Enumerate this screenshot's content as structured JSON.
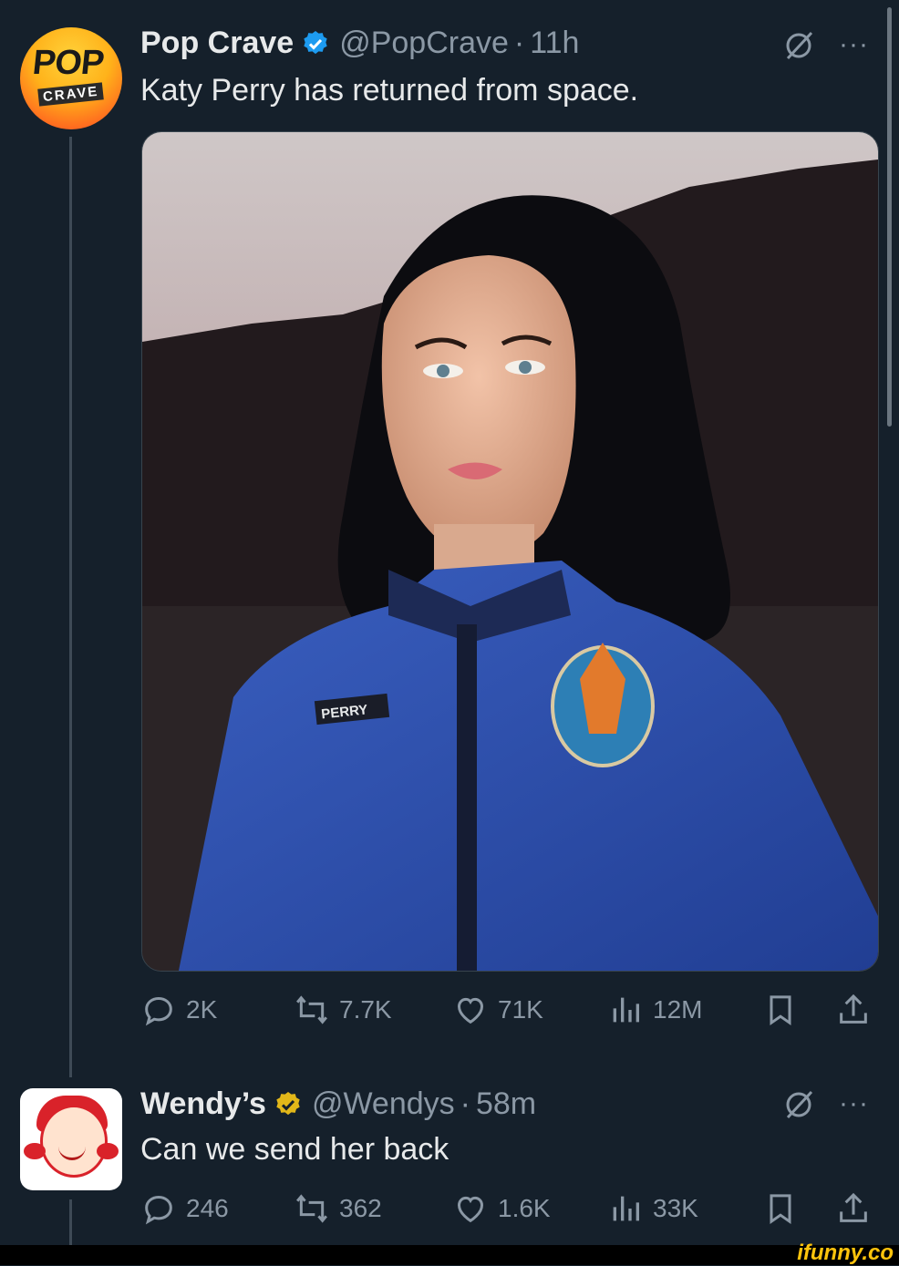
{
  "tweets": [
    {
      "name": "Pop Crave",
      "handle": "@PopCrave",
      "separator": "·",
      "time": "11h",
      "text": "Katy Perry has returned from space.",
      "avatar_word_top": "POP",
      "avatar_word_bottom": "CRAVE",
      "media_patch_text": "PERRY",
      "stats": {
        "replies": "2K",
        "reposts": "7.7K",
        "likes": "71K",
        "views": "12M"
      }
    },
    {
      "name": "Wendy’s",
      "handle": "@Wendys",
      "separator": "·",
      "time": "58m",
      "text": "Can we send her back",
      "stats": {
        "replies": "246",
        "reposts": "362",
        "likes": "1.6K",
        "views": "33K"
      }
    }
  ],
  "more_glyph": "···",
  "watermark": "ifunny.co",
  "colors": {
    "background": "#15202b",
    "text": "#e7e9ea",
    "muted": "#8b98a5",
    "verified_blue": "#1d9bf0",
    "verified_gold": "#e2b719",
    "watermark": "#ffc40c"
  },
  "icons": [
    "verified-badge-icon",
    "grok-icon",
    "more-icon",
    "reply-icon",
    "repost-icon",
    "like-icon",
    "views-icon",
    "bookmark-icon",
    "share-icon"
  ]
}
